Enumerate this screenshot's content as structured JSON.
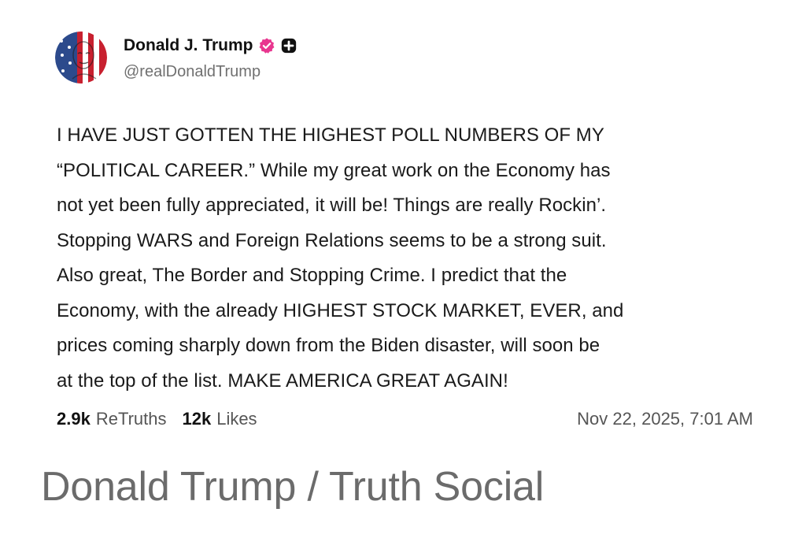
{
  "post": {
    "author_name": "Donald J. Trump",
    "handle": "@realDonaldTrump",
    "verified_icon": "verified-badge-icon",
    "extra_badge_icon": "plus-shield-icon",
    "body": "I HAVE JUST GOTTEN THE HIGHEST POLL NUMBERS OF MY\n“POLITICAL CAREER.” While my great work on the Economy has\nnot yet been fully appreciated, it will be! Things are really Rockin’.\nStopping WARS and Foreign Relations seems to be a strong suit.\nAlso great, The Border and Stopping Crime. I predict that the\nEconomy, with the already HIGHEST STOCK MARKET, EVER, and\nprices coming sharply down from the Biden disaster, will soon be\nat the top of the list. MAKE AMERICA GREAT AGAIN!",
    "retruths_count": "2.9k",
    "retruths_label": "ReTruths",
    "likes_count": "12k",
    "likes_label": "Likes",
    "timestamp": "Nov 22, 2025, 7:01 AM"
  },
  "caption": "Donald Trump / Truth Social",
  "colors": {
    "verified_badge": "#e8368f",
    "text": "#1a1a1a",
    "muted": "#707070",
    "caption": "#6b6b6b"
  }
}
